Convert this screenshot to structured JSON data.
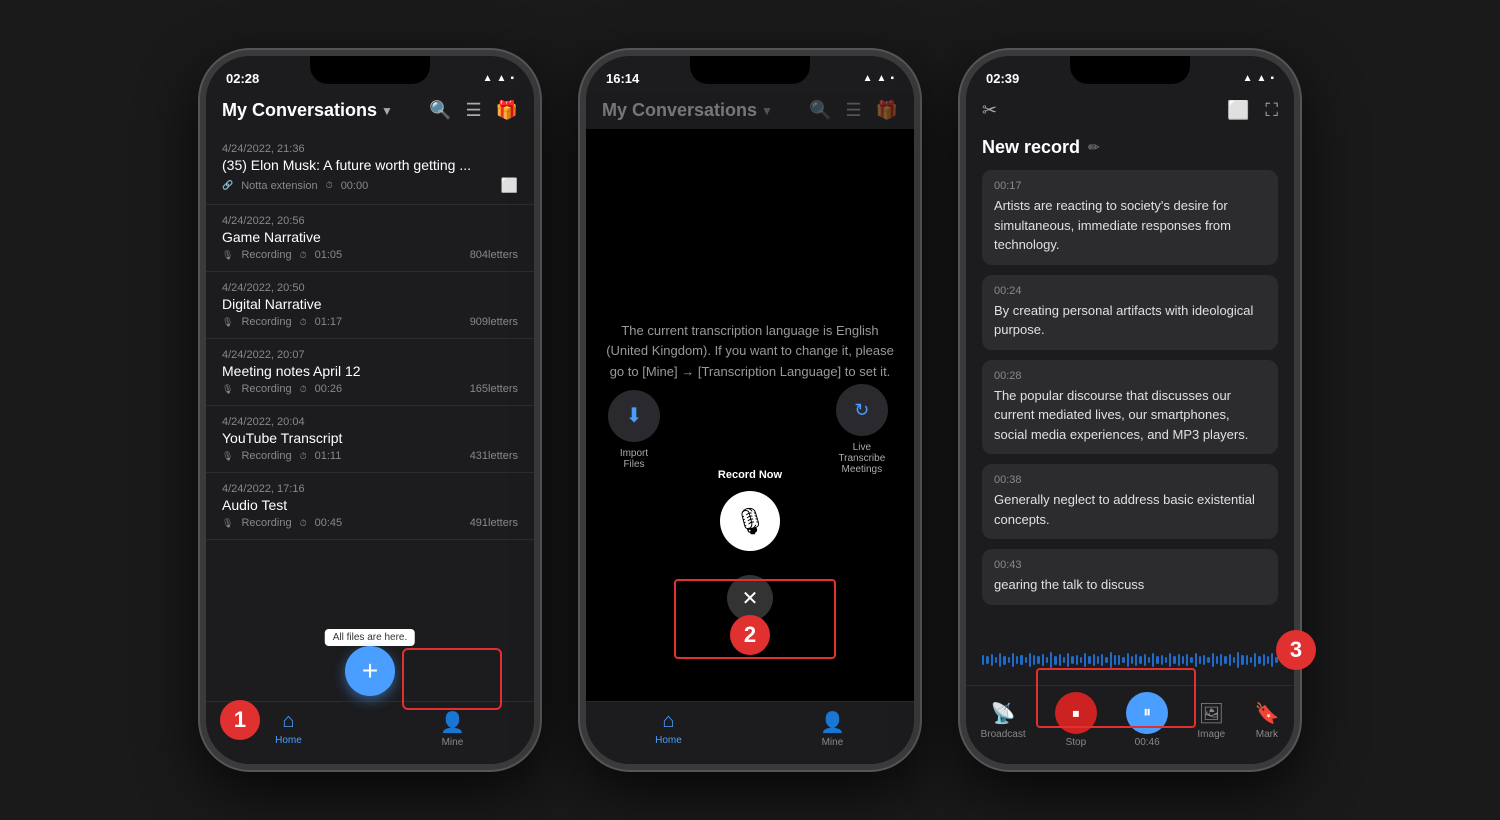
{
  "phone1": {
    "status": {
      "time": "02:28",
      "signal": "▲",
      "wifi": "WiFi",
      "battery": "🔋"
    },
    "header": {
      "title": "My Conversations",
      "dropdown": "▼"
    },
    "conversations": [
      {
        "date": "4/24/2022, 21:36",
        "title": "(35) Elon Musk: A future worth getting ...",
        "source": "Notta extension",
        "duration": "00:00",
        "letters": ""
      },
      {
        "date": "4/24/2022, 20:56",
        "title": "Game Narrative",
        "source": "Recording",
        "duration": "01:05",
        "letters": "804letters"
      },
      {
        "date": "4/24/2022, 20:50",
        "title": "Digital Narrative",
        "source": "Recording",
        "duration": "01:17",
        "letters": "909letters"
      },
      {
        "date": "4/24/2022, 20:07",
        "title": "Meeting notes April 12",
        "source": "Recording",
        "duration": "00:26",
        "letters": "165letters"
      },
      {
        "date": "4/24/2022, 20:04",
        "title": "YouTube Transcript",
        "source": "Recording",
        "duration": "01:11",
        "letters": "431letters"
      },
      {
        "date": "4/24/2022, 17:16",
        "title": "Audio Test",
        "source": "Recording",
        "duration": "00:45",
        "letters": "491letters"
      }
    ],
    "nav": {
      "home": "Home",
      "mine": "Mine"
    },
    "fab_tooltip": "All files are here.",
    "badge_number": "1"
  },
  "phone2": {
    "status": {
      "time": "16:14"
    },
    "header_title": "My Conversations",
    "message": "The current transcription language is English (United Kingdom). If you want to change it, please go to [Mine] → [Transcription Language] to set it.",
    "menu": {
      "record_now_label": "Record Now",
      "import_files_label": "Import Files",
      "live_transcribe_label": "Live Transcribe Meetings"
    },
    "badge_number": "2"
  },
  "phone3": {
    "status": {
      "time": "02:39"
    },
    "title": "New record",
    "transcript": [
      {
        "time": "00:17",
        "text": "Artists are reacting to society's desire for simultaneous, immediate responses from technology."
      },
      {
        "time": "00:24",
        "text": "By creating personal artifacts with ideological purpose."
      },
      {
        "time": "00:28",
        "text": "The popular discourse that discusses our current mediated lives, our smartphones, social media experiences, and MP3 players."
      },
      {
        "time": "00:38",
        "text": "Generally neglect to address basic existential concepts."
      },
      {
        "time": "00:43",
        "text": "gearing the talk to discuss"
      }
    ],
    "controls": {
      "broadcast": "Broadcast",
      "stop": "Stop",
      "timer": "00:46",
      "image": "Image",
      "mark": "Mark"
    },
    "badge_number": "3"
  }
}
